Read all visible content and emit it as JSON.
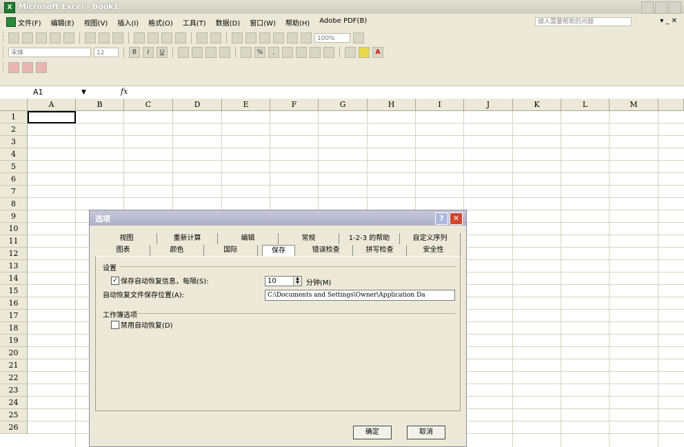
{
  "window": {
    "title": "Microsoft Excel - Book1"
  },
  "menu": {
    "items": [
      "文件(F)",
      "编辑(E)",
      "视图(V)",
      "插入(I)",
      "格式(O)",
      "工具(T)",
      "数据(D)",
      "窗口(W)",
      "帮助(H)",
      "Adobe PDF(B)"
    ],
    "help_placeholder": "键入需要帮助的问题",
    "doc_controls": "▾ _ ✕"
  },
  "toolbar": {
    "zoom": "100%",
    "font_name": "宋体",
    "font_size": "12"
  },
  "formula_bar": {
    "name_box": "A1",
    "fx": "fx"
  },
  "sheet": {
    "columns": [
      "A",
      "B",
      "C",
      "D",
      "E",
      "F",
      "G",
      "H",
      "I",
      "J",
      "K",
      "L",
      "M"
    ],
    "rows": [
      "1",
      "2",
      "3",
      "4",
      "5",
      "6",
      "7",
      "8",
      "9",
      "10",
      "11",
      "12",
      "13",
      "14",
      "15",
      "16",
      "17",
      "18",
      "19",
      "20",
      "21",
      "22",
      "23",
      "24",
      "25",
      "26"
    ]
  },
  "dialog": {
    "title": "选项",
    "tabs_row1": [
      "视图",
      "重新计算",
      "编辑",
      "常规",
      "1-2-3 的帮助",
      "自定义序列"
    ],
    "tabs_row2": [
      "图表",
      "颜色",
      "国际",
      "保存",
      "错误检查",
      "拼写检查",
      "安全性"
    ],
    "settings_group": "设置",
    "autorecover_label": "保存自动恢复信息，每隔(S):",
    "autorecover_checked": "✓",
    "minutes_value": "10",
    "minutes_unit": "分钟(M)",
    "location_label": "自动恢复文件保存位置(A):",
    "location_value": "C:\\Documents and Settings\\Owner\\Application Da",
    "workbook_group": "工作簿选项",
    "disable_autorecover_label": "禁用自动恢复(D)",
    "ok": "确定",
    "cancel": "取消",
    "help_glyph": "?",
    "close_glyph": "✕"
  }
}
